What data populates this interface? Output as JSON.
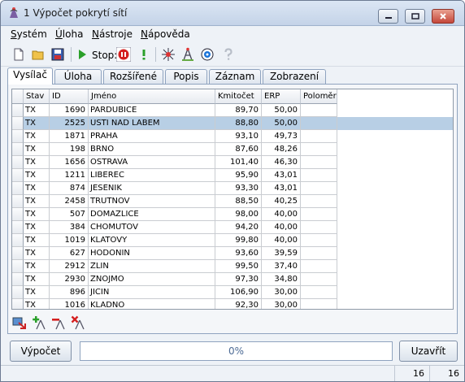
{
  "window": {
    "title": "1 Výpočet pokrytí sítí"
  },
  "menu": {
    "items": [
      {
        "pre": "",
        "u": "S",
        "post": "ystém"
      },
      {
        "pre": "",
        "u": "Ú",
        "post": "loha"
      },
      {
        "pre": "",
        "u": "N",
        "post": "ástroje"
      },
      {
        "pre": "",
        "u": "N",
        "post": "ápověda"
      }
    ]
  },
  "toolbar": {
    "stop_label": "Stop:"
  },
  "tabs": [
    "Vysílač",
    "Úloha",
    "Rozšířené",
    "Popis",
    "Záznam",
    "Zobrazení"
  ],
  "table": {
    "headers": {
      "stav": "Stav",
      "id": "ID",
      "jmeno": "Jméno",
      "kmitocet": "Kmitočet",
      "erp": "ERP",
      "polomer": "Poloměr"
    },
    "rows": [
      {
        "stav": "TX",
        "id": "1690",
        "jmeno": "PARDUBICE",
        "kmitocet": "89,70",
        "erp": "50,00",
        "polomer": "",
        "selected": false
      },
      {
        "stav": "TX",
        "id": "2525",
        "jmeno": "USTI NAD LABEM",
        "kmitocet": "88,80",
        "erp": "50,00",
        "polomer": "",
        "selected": true
      },
      {
        "stav": "TX",
        "id": "1871",
        "jmeno": "PRAHA",
        "kmitocet": "93,10",
        "erp": "49,73",
        "polomer": "",
        "selected": false
      },
      {
        "stav": "TX",
        "id": "198",
        "jmeno": "BRNO",
        "kmitocet": "87,60",
        "erp": "48,26",
        "polomer": "",
        "selected": false
      },
      {
        "stav": "TX",
        "id": "1656",
        "jmeno": "OSTRAVA",
        "kmitocet": "101,40",
        "erp": "46,30",
        "polomer": "",
        "selected": false
      },
      {
        "stav": "TX",
        "id": "1211",
        "jmeno": "LIBEREC",
        "kmitocet": "95,90",
        "erp": "43,01",
        "polomer": "",
        "selected": false
      },
      {
        "stav": "TX",
        "id": "874",
        "jmeno": "JESENIK",
        "kmitocet": "93,30",
        "erp": "43,01",
        "polomer": "",
        "selected": false
      },
      {
        "stav": "TX",
        "id": "2458",
        "jmeno": "TRUTNOV",
        "kmitocet": "88,50",
        "erp": "40,25",
        "polomer": "",
        "selected": false
      },
      {
        "stav": "TX",
        "id": "507",
        "jmeno": "DOMAZLICE",
        "kmitocet": "98,00",
        "erp": "40,00",
        "polomer": "",
        "selected": false
      },
      {
        "stav": "TX",
        "id": "384",
        "jmeno": "CHOMUTOV",
        "kmitocet": "94,20",
        "erp": "40,00",
        "polomer": "",
        "selected": false
      },
      {
        "stav": "TX",
        "id": "1019",
        "jmeno": "KLATOVY",
        "kmitocet": "99,80",
        "erp": "40,00",
        "polomer": "",
        "selected": false
      },
      {
        "stav": "TX",
        "id": "627",
        "jmeno": "HODONIN",
        "kmitocet": "93,60",
        "erp": "39,59",
        "polomer": "",
        "selected": false
      },
      {
        "stav": "TX",
        "id": "2912",
        "jmeno": "ZLIN",
        "kmitocet": "99,50",
        "erp": "37,40",
        "polomer": "",
        "selected": false
      },
      {
        "stav": "TX",
        "id": "2930",
        "jmeno": "ZNOJMO",
        "kmitocet": "97,30",
        "erp": "34,80",
        "polomer": "",
        "selected": false
      },
      {
        "stav": "TX",
        "id": "896",
        "jmeno": "JICIN",
        "kmitocet": "106,90",
        "erp": "30,00",
        "polomer": "",
        "selected": false
      },
      {
        "stav": "TX",
        "id": "1016",
        "jmeno": "KLADNO",
        "kmitocet": "92,30",
        "erp": "30,00",
        "polomer": "",
        "selected": false
      }
    ]
  },
  "actions": {
    "compute": "Výpočet",
    "close": "Uzavřít"
  },
  "progress": {
    "value": 0,
    "text": "0%"
  },
  "status": {
    "count_a": "16",
    "count_b": "16"
  },
  "icons": {
    "window": "app-icon",
    "new": "new-file-icon",
    "open": "open-folder-icon",
    "save": "save-icon",
    "run": "play-icon",
    "stop": "stop-icon",
    "warn": "exclamation-icon",
    "site": "transmitter-icon",
    "antenna": "antenna-icon",
    "map": "map-icon",
    "help": "help-icon"
  },
  "colors": {
    "selected_row": "#b8cfe5",
    "title_gradient_top": "#dbe6f4",
    "progress_text": "#4d6b95"
  }
}
